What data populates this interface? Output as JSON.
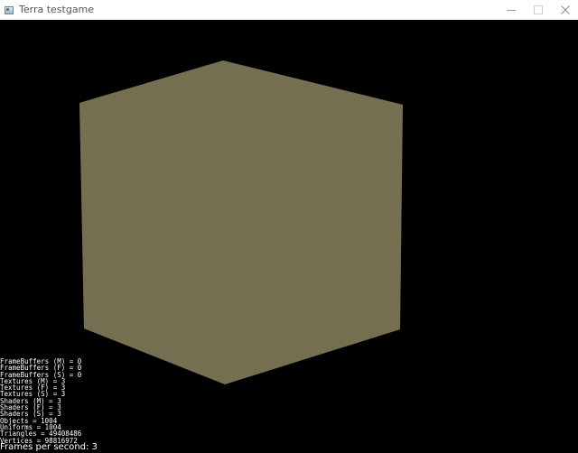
{
  "window": {
    "title": "Terra testgame",
    "app_icon": "window-app-icon",
    "controls": {
      "minimize_icon": "minimize-icon",
      "maximize_icon": "maximize-icon",
      "close_icon": "close-icon"
    }
  },
  "scene": {
    "background": "#000000",
    "cube_color": "#7a7455"
  },
  "stats": {
    "lines": [
      "FrameBuffers (M) = 0",
      "FrameBuffers (F) = 0",
      "FrameBuffers (S) = 0",
      "Textures (M) = 3",
      "Textures (F) = 3",
      "Textures (S) = 3",
      "Shaders (M) = 3",
      "Shaders (F) = 3",
      "Shaders (S) = 3",
      "Objects = 1004",
      "Uniforms = 1004",
      "Triangles = 49408486",
      "Vertices = 98816972"
    ],
    "fps_text": "Frames per second: 3"
  }
}
